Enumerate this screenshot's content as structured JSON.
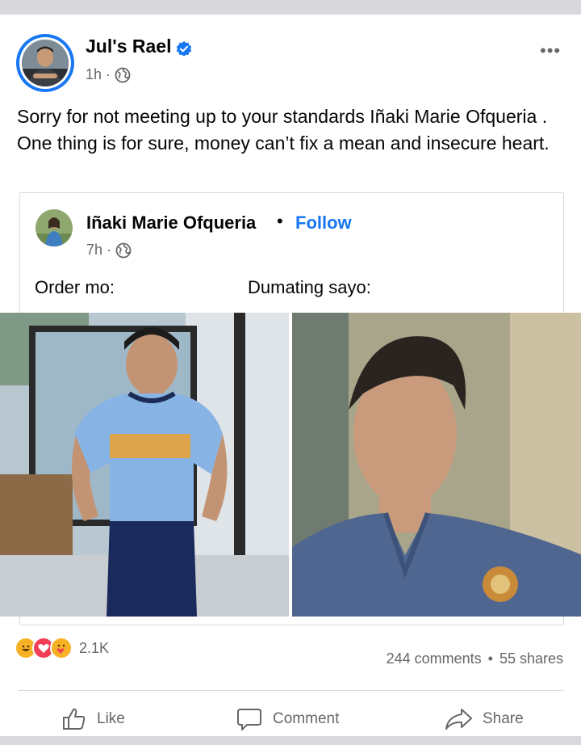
{
  "post": {
    "author": "Jul's Rael",
    "time": "1h",
    "separator": "·",
    "more_label": "•••",
    "text": "Sorry for not meeting up to your standards Iñaki Marie Ofqueria . One thing is for sure, money can’t fix a mean and insecure heart."
  },
  "shared_post": {
    "author": "Iñaki Marie Ofqueria",
    "dot": "•",
    "follow_label": "Follow",
    "time": "7h",
    "separator": "·",
    "caption_left": "Order mo:",
    "caption_right": "Dumating sayo:"
  },
  "engagement": {
    "reaction_count": "2.1K",
    "comments": "244 comments",
    "stat_separator": "•",
    "shares": "55 shares"
  },
  "actions": {
    "like_label": "Like",
    "comment_label": "Comment",
    "share_label": "Share"
  },
  "colors": {
    "accent": "#1877f2",
    "meta_text": "#65676b",
    "divider": "#d7d9dd"
  }
}
